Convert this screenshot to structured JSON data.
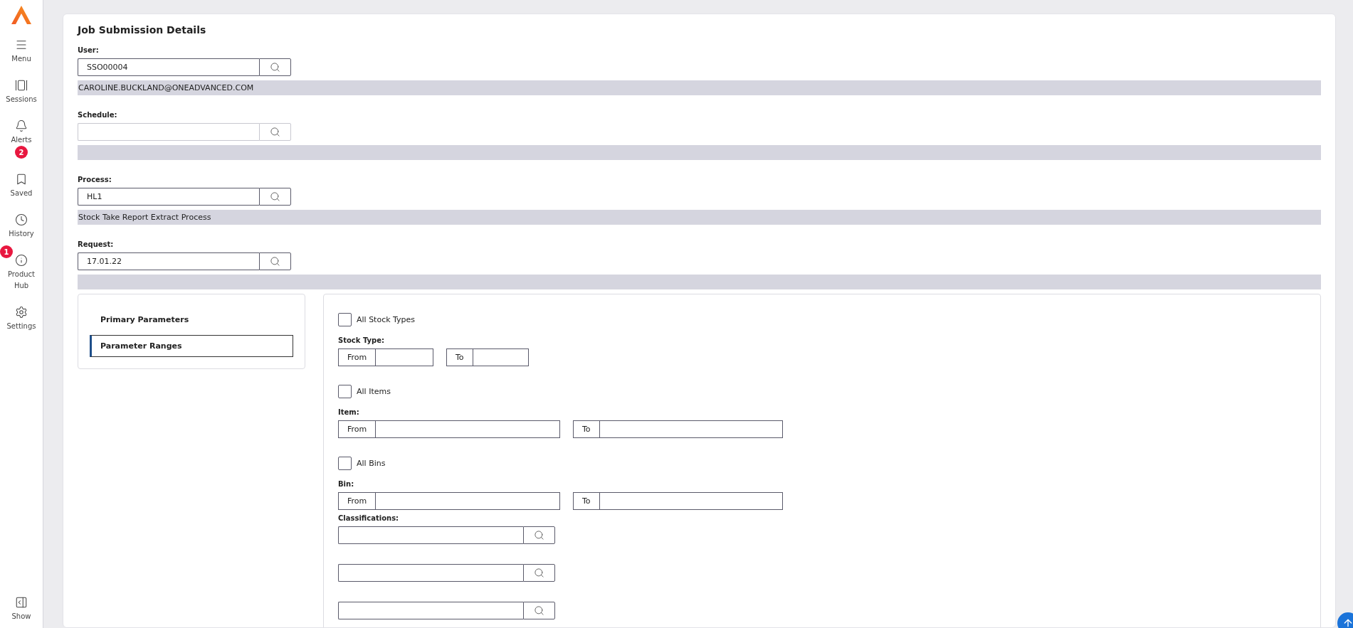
{
  "sidebar": {
    "items": [
      {
        "kind": "menu",
        "label": "Menu"
      },
      {
        "kind": "sessions",
        "label": "Sessions"
      },
      {
        "kind": "alerts",
        "label": "Alerts",
        "badge": "2"
      },
      {
        "kind": "saved",
        "label": "Saved"
      },
      {
        "kind": "history",
        "label": "History"
      },
      {
        "kind": "info",
        "label": "Product Hub",
        "corner_badge": "1"
      },
      {
        "kind": "settings",
        "label": "Settings"
      }
    ],
    "footer": {
      "kind": "show",
      "label": "Show"
    }
  },
  "card": {
    "title": "Job Submission Details",
    "fields": [
      {
        "label": "User:",
        "value": "SSO00004",
        "description": "CAROLINE.BUCKLAND@ONEADVANCED.COM",
        "disabled": false
      },
      {
        "label": "Schedule:",
        "disabled": true
      },
      {
        "label": "Process:",
        "value": "HL1",
        "description": "Stock Take Report Extract Process",
        "disabled": false
      },
      {
        "label": "Request:",
        "value": "17.01.22",
        "disabled": false
      }
    ]
  },
  "parameters": {
    "tabs": [
      {
        "label": "Primary Parameters",
        "selected": false
      },
      {
        "label": "Parameter Ranges",
        "selected": true
      }
    ],
    "ranges": [
      {
        "checkbox": {
          "label": "All Stock Types",
          "checked": false
        },
        "label": "Stock Type:",
        "from": "From",
        "to": "To",
        "kind": "short"
      },
      {
        "checkbox": {
          "label": "All Items",
          "checked": false
        },
        "label": "Item:",
        "from": "From",
        "to": "To",
        "kind": "long"
      },
      {
        "checkbox": {
          "label": "All Bins",
          "checked": false
        },
        "label": "Bin:",
        "from": "From",
        "to": "To",
        "kind": "long"
      }
    ],
    "classifications": {
      "label": "Classifications:",
      "fields": [
        {
          "kind": "search"
        },
        {
          "kind": "search"
        },
        {
          "kind": "search"
        }
      ]
    }
  }
}
